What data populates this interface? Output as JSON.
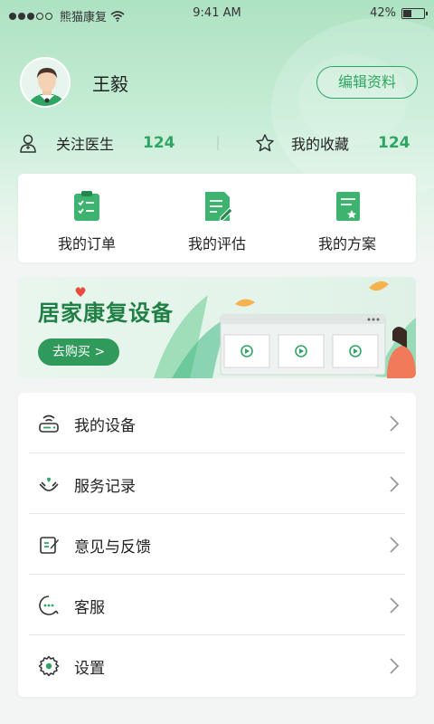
{
  "status_bar": {
    "carrier": "熊猫康复",
    "time": "9:41 AM",
    "battery": "42%",
    "battery_level": 0.42,
    "signal_bars": 3,
    "signal_total": 5
  },
  "profile": {
    "name": "王毅",
    "edit_label": "编辑资料"
  },
  "stats": [
    {
      "label": "关注医生",
      "value": "124",
      "icon": "doctor-icon"
    },
    {
      "label": "我的收藏",
      "value": "124",
      "icon": "star-icon"
    }
  ],
  "quick_actions": [
    {
      "label": "我的订单",
      "icon": "order-clipboard-icon"
    },
    {
      "label": "我的评估",
      "icon": "assessment-icon"
    },
    {
      "label": "我的方案",
      "icon": "plan-icon"
    }
  ],
  "banner": {
    "title": "居家康复设备",
    "button_label": "去购买 >"
  },
  "menu": [
    {
      "label": "我的设备",
      "icon": "device-icon"
    },
    {
      "label": "服务记录",
      "icon": "service-record-icon"
    },
    {
      "label": "意见与反馈",
      "icon": "feedback-icon"
    },
    {
      "label": "客服",
      "icon": "customer-service-icon"
    },
    {
      "label": "设置",
      "icon": "settings-icon"
    }
  ],
  "colors": {
    "accent": "#2fa564",
    "accent_dark": "#1f7f44",
    "background": "#f3f5f4",
    "header_gradient_top": "#aee2c3"
  }
}
